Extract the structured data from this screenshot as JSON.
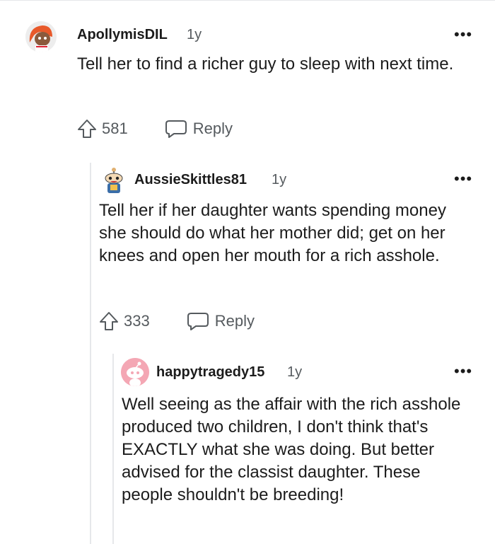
{
  "comments": [
    {
      "username": "ApollymisDIL",
      "age": "1y",
      "more_label": "•••",
      "text": "Tell her to find a richer guy to sleep with next time.",
      "upvotes": "581",
      "reply_label": "Reply",
      "avatar_colors": {
        "bg": "#f0f0f0",
        "accent": "#e8592a"
      }
    },
    {
      "username": "AussieSkittles81",
      "age": "1y",
      "more_label": "•••",
      "text": "Tell her if her daughter wants spending money she should do what her mother did; get on her knees and open her mouth for a rich asshole.",
      "upvotes": "333",
      "reply_label": "Reply",
      "avatar_colors": {
        "bg": "#ffffff",
        "accent": "#3b6ea8"
      }
    },
    {
      "username": "happytragedy15",
      "age": "1y",
      "more_label": "•••",
      "text": "Well seeing as the affair with the rich asshole produced two children, I don't think that's EXACTLY what she was doing. But better advised for the classist daughter. These people shouldn't be breeding!",
      "avatar_colors": {
        "bg": "#f4a7b4",
        "accent": "#ffffff"
      }
    }
  ]
}
